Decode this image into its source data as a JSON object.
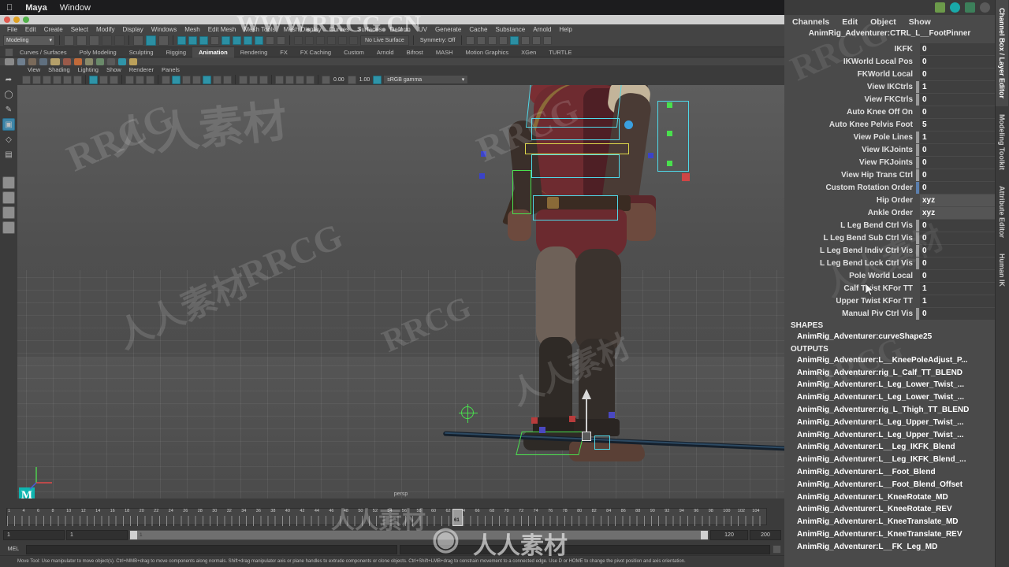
{
  "os": {
    "apple_icon": "apple-icon",
    "app_name": "Maya",
    "window_menu": "Window"
  },
  "menubar": {
    "items": [
      "File",
      "Edit",
      "Create",
      "Select",
      "Modify",
      "Display",
      "Windows",
      "Mesh",
      "Edit Mesh",
      "Mesh Tools",
      "Mesh Display",
      "Curves",
      "Surfaces",
      "Deform",
      "UV",
      "Generate",
      "Cache",
      "Substance",
      "Arnold",
      "Help"
    ]
  },
  "statusline": {
    "menu_set": "Modeling",
    "live_surface": "No Live Surface",
    "symmetry": "Symmetry: Off"
  },
  "shelf": {
    "tabs": [
      "Curves / Surfaces",
      "Poly Modeling",
      "Sculpting",
      "Rigging",
      "Animation",
      "Rendering",
      "FX",
      "FX Caching",
      "Custom",
      "Arnold",
      "Bifrost",
      "MASH",
      "Motion Graphics",
      "XGen",
      "TURTLE"
    ],
    "active_tab": "Animation"
  },
  "viewport": {
    "menu": [
      "View",
      "Shading",
      "Lighting",
      "Show",
      "Renderer",
      "Panels"
    ],
    "exposure_value": "0.00",
    "gamma_value": "1.00",
    "color_space": "sRGB gamma",
    "camera_label": "persp",
    "axis_gizmo": "axis-gizmo-icon",
    "maya_logo": "M"
  },
  "timeline": {
    "tick_labels": [
      "1",
      "4",
      "6",
      "8",
      "10",
      "12",
      "14",
      "16",
      "18",
      "20",
      "22",
      "24",
      "26",
      "28",
      "30",
      "32",
      "34",
      "36",
      "38",
      "40",
      "42",
      "44",
      "46",
      "48",
      "50",
      "52",
      "54",
      "56",
      "58",
      "60",
      "62",
      "64",
      "66",
      "68",
      "70",
      "72",
      "74",
      "76",
      "78",
      "80",
      "82",
      "84",
      "86",
      "88",
      "90",
      "92",
      "94",
      "96",
      "98",
      "100",
      "102",
      "104"
    ],
    "current_frame": "61",
    "range_start": "1",
    "range_end": "1",
    "playback_start": "1",
    "playback_end": "120",
    "anim_end": "200"
  },
  "mel": {
    "label": "MEL",
    "value": ""
  },
  "helpline": {
    "text": "Move Tool: Use manipulator to move object(s). Ctrl+MMB+drag to move components along normals. Shift+drag manipulator axis or plane handles to extrude components or clone objects. Ctrl+Shift+LMB+drag to constrain movement to a connected edge. Use D or HOME to change the pivot position and axis orientation."
  },
  "channel_box": {
    "menu": [
      "Channels",
      "Edit",
      "Object",
      "Show"
    ],
    "node_title": "AnimRig_Adventurer:CTRL_L__FootPinner",
    "attributes": [
      {
        "name": "IKFK",
        "value": "0",
        "lock": "none"
      },
      {
        "name": "IKWorld Local Pos",
        "value": "0",
        "lock": "none"
      },
      {
        "name": "FKWorld Local",
        "value": "0",
        "lock": "none"
      },
      {
        "name": "View IKCtrls",
        "value": "1",
        "lock": "grey"
      },
      {
        "name": "View FKCtrls",
        "value": "0",
        "lock": "grey"
      },
      {
        "name": "Auto Knee Off On",
        "value": "0",
        "lock": "none"
      },
      {
        "name": "Auto Knee Pelvis Foot",
        "value": "5",
        "lock": "none"
      },
      {
        "name": "View Pole Lines",
        "value": "1",
        "lock": "grey"
      },
      {
        "name": "View IKJoints",
        "value": "0",
        "lock": "grey"
      },
      {
        "name": "View FKJoints",
        "value": "0",
        "lock": "grey"
      },
      {
        "name": "View Hip Trans Ctrl",
        "value": "0",
        "lock": "grey"
      },
      {
        "name": "Custom Rotation Order",
        "value": "0",
        "lock": "blue"
      },
      {
        "name": "Hip Order",
        "value": "xyz",
        "lock": "none",
        "plain": true
      },
      {
        "name": "Ankle Order",
        "value": "xyz",
        "lock": "none",
        "plain": true
      },
      {
        "name": "L Leg Bend Ctrl Vis",
        "value": "0",
        "lock": "grey"
      },
      {
        "name": "L Leg Bend Sub Ctrl Vis",
        "value": "0",
        "lock": "grey"
      },
      {
        "name": "L Leg Bend Indiv Ctrl Vis",
        "value": "0",
        "lock": "grey"
      },
      {
        "name": "L Leg Bend Lock Ctrl Vis",
        "value": "0",
        "lock": "grey"
      },
      {
        "name": "Pole World Local",
        "value": "0",
        "lock": "none"
      },
      {
        "name": "Calf Twist KFor TT",
        "value": "1",
        "lock": "none"
      },
      {
        "name": "Upper Twist KFor TT",
        "value": "1",
        "lock": "none"
      },
      {
        "name": "Manual Piv Ctrl Vis",
        "value": "0",
        "lock": "grey"
      }
    ],
    "shapes_header": "SHAPES",
    "shapes": [
      "AnimRig_Adventurer:curveShape25"
    ],
    "outputs_header": "OUTPUTS",
    "outputs": [
      "AnimRig_Adventurer:L__KneePoleAdjust_P...",
      "AnimRig_Adventurer:rig_L_Calf_TT_BLEND",
      "AnimRig_Adventurer:L_Leg_Lower_Twist_...",
      "AnimRig_Adventurer:L_Leg_Lower_Twist_...",
      "AnimRig_Adventurer:rig_L_Thigh_TT_BLEND",
      "AnimRig_Adventurer:L_Leg_Upper_Twist_...",
      "AnimRig_Adventurer:L_Leg_Upper_Twist_...",
      "AnimRig_Adventurer:L__Leg_IKFK_Blend",
      "AnimRig_Adventurer:L__Leg_IKFK_Blend_...",
      "AnimRig_Adventurer:L__Foot_Blend",
      "AnimRig_Adventurer:L__Foot_Blend_Offset",
      "AnimRig_Adventurer:L_KneeRotate_MD",
      "AnimRig_Adventurer:L_KneeRotate_REV",
      "AnimRig_Adventurer:L_KneeTranslate_MD",
      "AnimRig_Adventurer:L_KneeTranslate_REV",
      "AnimRig_Adventurer:L__FK_Leg_MD"
    ]
  },
  "vertical_tabs": [
    "Channel Box / Layer Editor",
    "Modeling Toolkit",
    "Attribute Editor",
    "Human IK"
  ],
  "watermarks": {
    "url": "WWW.RRCG.CN",
    "brand_cn": "人人素材",
    "brand_en": "RRCG"
  },
  "colors": {
    "accent_cyan": "#2f94a8",
    "panel_bg": "#4a4a4a",
    "app_bg": "#3b3b3b",
    "viewport_bg": "#555555",
    "ctrl_cyan": "#4fd8e8",
    "ctrl_yellow": "#ddd84a",
    "ctrl_green": "#49e04d",
    "ctrl_blue": "#4a5ae0",
    "ctrl_red": "#e04a4a"
  }
}
